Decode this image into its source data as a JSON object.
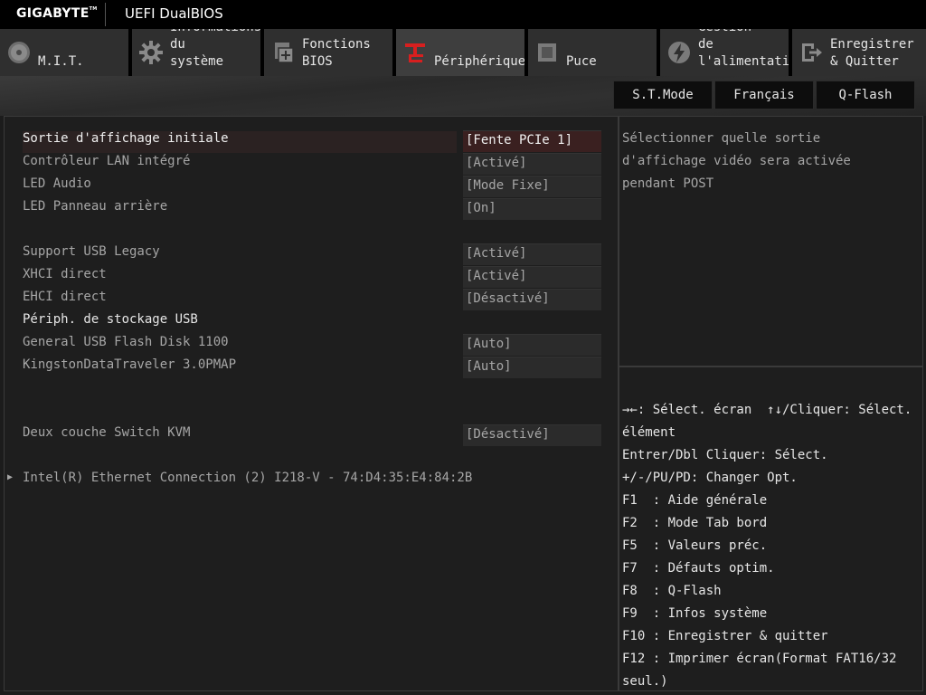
{
  "titlebar": {
    "brand": "GIGABYTE",
    "app_title": "UEFI DualBIOS"
  },
  "tabs": [
    {
      "label": "M.I.T.",
      "icon": "disc-icon"
    },
    {
      "label": "Informations\ndu\nsystème",
      "icon": "gear-icon"
    },
    {
      "label": "Fonctions\nBIOS",
      "icon": "chip-plus-icon"
    },
    {
      "label": "Périphériques",
      "icon": "peripherals-icon",
      "active": true
    },
    {
      "label": "Puce",
      "icon": "chipset-icon"
    },
    {
      "label": "Gestion\nde\nl'alimentation",
      "icon": "power-bolt-icon"
    },
    {
      "label": "Enregistrer\n& Quitter",
      "icon": "exit-icon"
    }
  ],
  "toolbar": {
    "stmode": "S.T.Mode",
    "language": "Français",
    "qflash": "Q-Flash"
  },
  "settings": [
    {
      "label": "Sortie d'affichage initiale",
      "value": "[Fente PCIe 1]",
      "selected": true
    },
    {
      "label": "Contrôleur LAN intégré",
      "value": "[Activé]"
    },
    {
      "label": "LED Audio",
      "value": "[Mode Fixe]"
    },
    {
      "label": "LED Panneau arrière",
      "value": "[On]"
    },
    {
      "label": "Support USB Legacy",
      "value": "[Activé]"
    },
    {
      "label": "XHCI direct",
      "value": "[Activé]"
    },
    {
      "label": "EHCI direct",
      "value": "[Désactivé]"
    },
    {
      "label": "Périph. de stockage USB",
      "value": null,
      "header": true
    },
    {
      "label": "General USB Flash Disk 1100",
      "value": "[Auto]"
    },
    {
      "label": "KingstonDataTraveler 3.0PMAP",
      "value": "[Auto]"
    },
    {
      "label": "Deux couche Switch KVM",
      "value": "[Désactivé]"
    },
    {
      "label": "Intel(R) Ethernet Connection (2) I218-V - 74:D4:35:E4:84:2B",
      "value": null,
      "submenu": true
    }
  ],
  "help": {
    "text": "Sélectionner quelle sortie d'affichage vidéo sera activée pendant POST"
  },
  "keys": [
    "→←: Sélect. écran  ↑↓/Cliquer: Sélect. élément",
    "Entrer/Dbl Cliquer: Sélect.",
    "+/-/PU/PD: Changer Opt.",
    "F1  : Aide générale",
    "F2  : Mode Tab bord",
    "F5  : Valeurs préc.",
    "F7  : Défauts optim.",
    "F8  : Q-Flash",
    "F9  : Infos système",
    "F10 : Enregistrer & quitter",
    "F12 : Imprimer écran(Format FAT16/32 seul.)"
  ],
  "colors": {
    "accent": "#d71f1f",
    "selected_row": "#3a2020"
  }
}
